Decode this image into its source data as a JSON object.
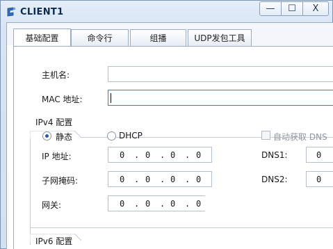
{
  "window": {
    "title": "CLIENT1",
    "minimize_glyph": "—",
    "maximize_glyph": "☐",
    "close_glyph": "X"
  },
  "tabs": [
    {
      "label": "基础配置",
      "active": true
    },
    {
      "label": "命令行",
      "active": false
    },
    {
      "label": "组播",
      "active": false
    },
    {
      "label": "UDP发包工具",
      "active": false
    }
  ],
  "form": {
    "hostname_label": "主机名:",
    "hostname_value": "",
    "mac_label": "MAC 地址:",
    "mac_value": ""
  },
  "ipv4": {
    "group_title": "IPv4 配置",
    "static_label": "静态",
    "static_selected": true,
    "dhcp_label": "DHCP",
    "auto_dns_label": "自动获取 DNS",
    "ip_label": "IP 地址:",
    "ip_octets": [
      "0",
      "0",
      "0",
      "0"
    ],
    "mask_label": "子网掩码:",
    "mask_octets": [
      "0",
      "0",
      "0",
      "0"
    ],
    "gateway_label": "网关:",
    "gateway_octets": [
      "0",
      "0",
      "0",
      "0"
    ],
    "dns1_label": "DNS1:",
    "dns1_first_octet": "0",
    "dns2_label": "DNS2:",
    "dns2_first_octet": "0"
  },
  "ipv6": {
    "group_title": "IPv6 配置"
  }
}
